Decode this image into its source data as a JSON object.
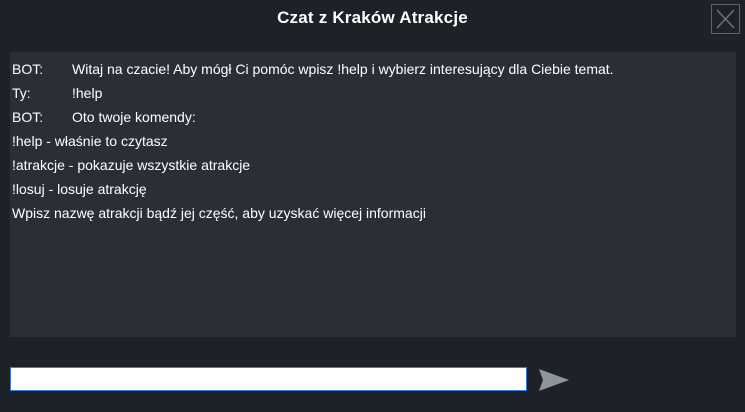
{
  "window": {
    "title": "Czat z Kraków Atrakcje"
  },
  "chat": {
    "messages": [
      {
        "sender": "BOT:",
        "text": "Witaj na czacie! Aby mógł Ci pomóc wpisz !help i wybierz interesujący dla Ciebie temat."
      },
      {
        "sender": "Ty:",
        "text": "!help"
      },
      {
        "sender": "BOT:",
        "text": "Oto twoje komendy:"
      }
    ],
    "lines": [
      "!help - właśnie to czytasz",
      "!atrakcje - pokazuje wszystkie atrakcje",
      "!losuj - losuje atrakcję",
      "Wpisz nazwę atrakcji bądź jej część, aby uzyskać więcej informacji"
    ]
  },
  "input": {
    "value": "",
    "placeholder": ""
  },
  "icons": {
    "close": "close-icon",
    "send": "send-arrow-icon"
  },
  "colors": {
    "background": "#1e2228",
    "chat_panel": "#2a2f37",
    "send_arrow": "#8d949c",
    "input_border": "#3a7bd5"
  }
}
